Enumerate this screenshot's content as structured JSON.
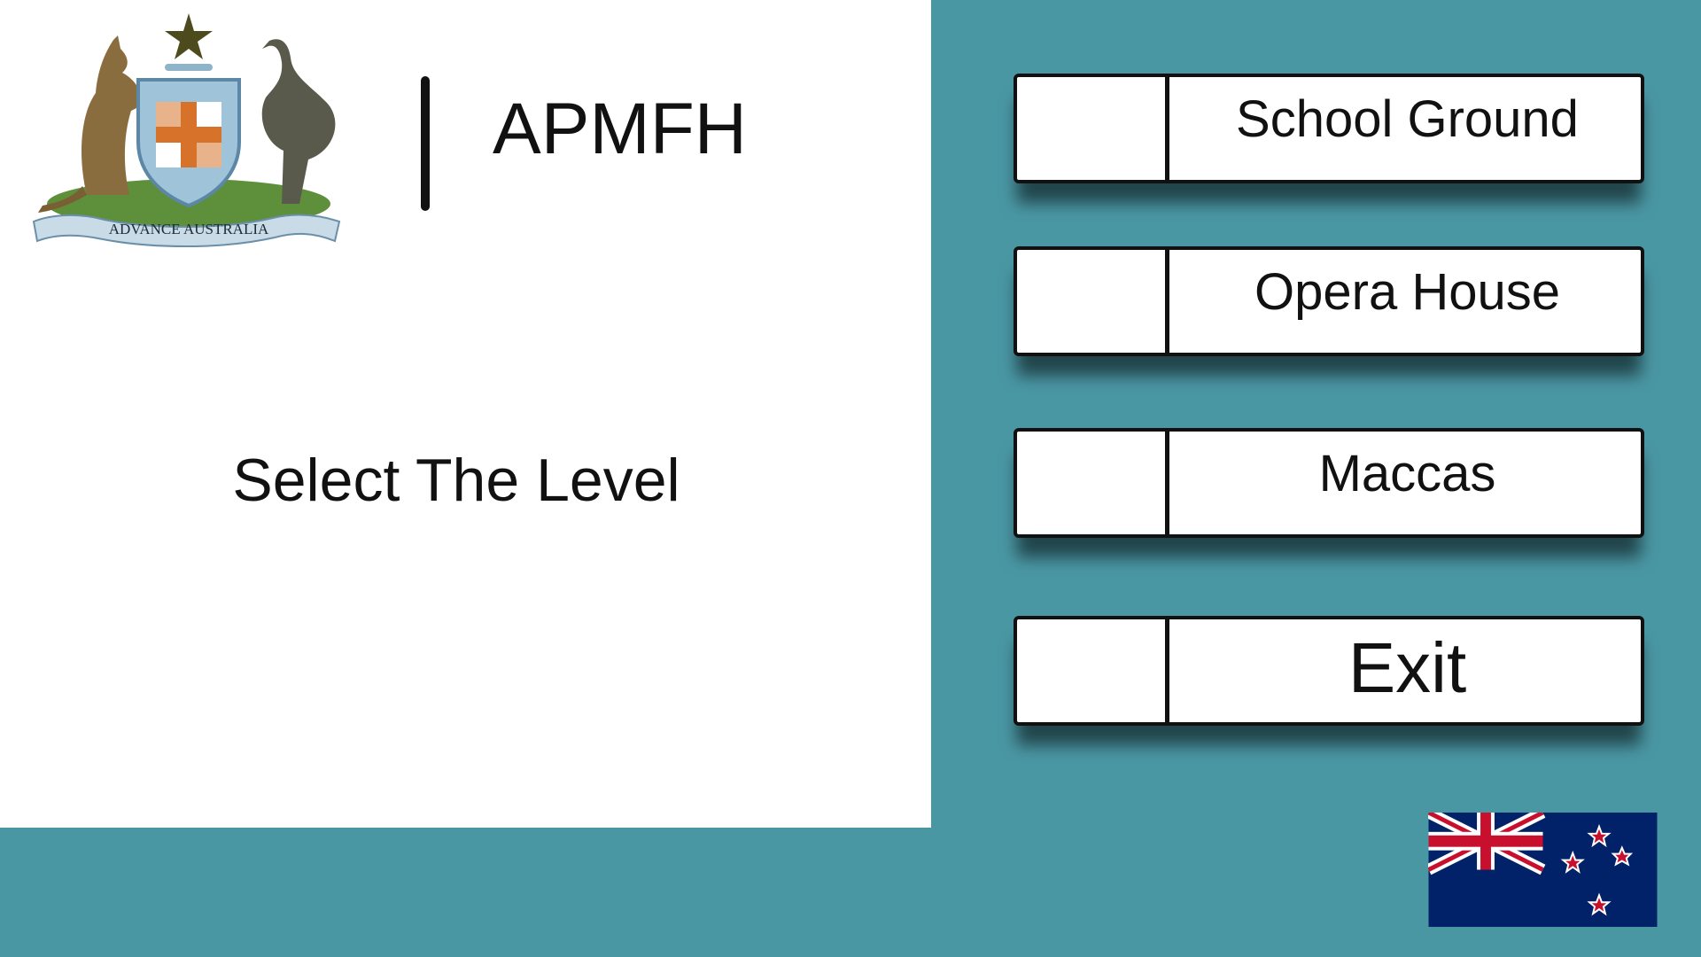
{
  "header": {
    "title": "APMFH",
    "emblem_motto": "ADVANCE AUSTRALIA"
  },
  "main": {
    "subtitle": "Select The Level"
  },
  "menu": {
    "buttons": [
      {
        "label": "School Ground"
      },
      {
        "label": "Opera House"
      },
      {
        "label": "Maccas"
      },
      {
        "label": "Exit"
      }
    ]
  },
  "colors": {
    "background": "#4a97a4",
    "panel": "#ffffff",
    "button_border": "#111111",
    "flag_blue": "#012169",
    "flag_red": "#c8102e"
  },
  "icons": {
    "emblem": "coat-of-arms-icon",
    "flag": "new-zealand-flag-icon"
  }
}
